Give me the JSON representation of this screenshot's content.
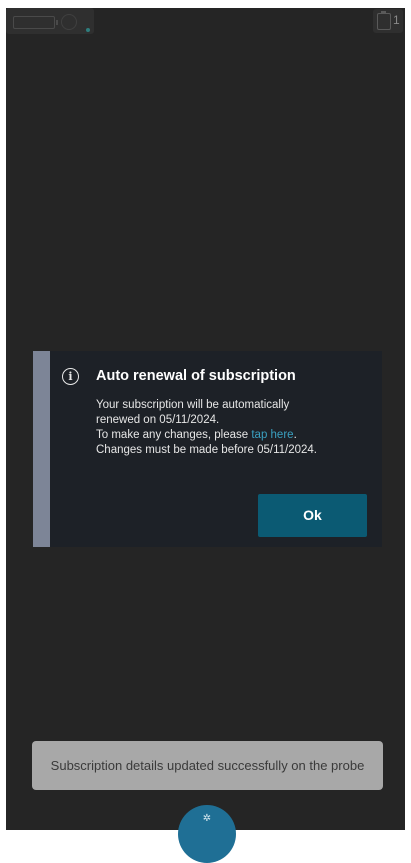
{
  "status_bar": {
    "notification_count": "1"
  },
  "dialog": {
    "title": "Auto renewal of subscription",
    "line1": "Your subscription will be automatically",
    "line2": "renewed on 05/11/2024.",
    "line3_prefix": "To make any changes, please ",
    "link_text": "tap here",
    "line3_suffix": ".",
    "line4": "Changes must be made before 05/11/2024.",
    "ok_label": "Ok"
  },
  "toast": {
    "message": "Subscription details updated successfully on the probe"
  },
  "colors": {
    "background": "#252525",
    "dialog_background": "#1d2127",
    "dialog_accent_bar": "#7d8597",
    "link": "#3aa0c0",
    "ok_button": "#0b5a73",
    "toast": "#a8a8a8",
    "probe_button": "#1f6f95"
  },
  "icons": {
    "info": "info-icon",
    "battery": "battery-icon",
    "signal": "signal-icon",
    "clipboard": "clipboard-icon",
    "probe": "probe-icon"
  }
}
